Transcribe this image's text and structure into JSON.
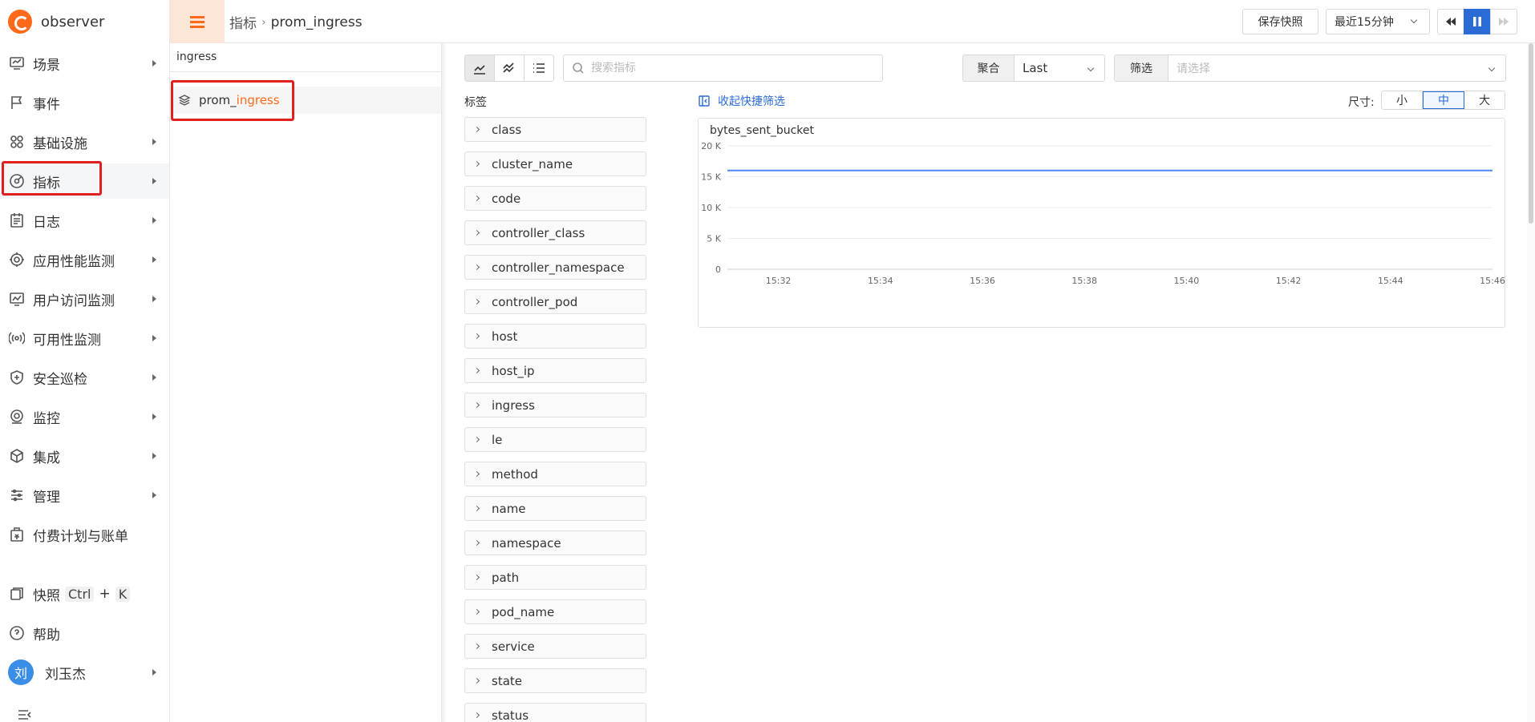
{
  "app": {
    "name": "observer"
  },
  "sidebar": {
    "items": [
      {
        "label": "场景",
        "icon": "dashboard-icon",
        "arrow": true
      },
      {
        "label": "事件",
        "icon": "flag-icon",
        "arrow": false
      },
      {
        "label": "基础设施",
        "icon": "grid-icon",
        "arrow": true
      },
      {
        "label": "指标",
        "icon": "metric-icon",
        "arrow": true
      },
      {
        "label": "日志",
        "icon": "log-icon",
        "arrow": true
      },
      {
        "label": "应用性能监测",
        "icon": "apm-icon",
        "arrow": true
      },
      {
        "label": "用户访问监测",
        "icon": "rum-icon",
        "arrow": true
      },
      {
        "label": "可用性监测",
        "icon": "signal-icon",
        "arrow": true
      },
      {
        "label": "安全巡检",
        "icon": "shield-icon",
        "arrow": true
      },
      {
        "label": "监控",
        "icon": "monitor-icon",
        "arrow": true
      },
      {
        "label": "集成",
        "icon": "cube-icon",
        "arrow": true
      },
      {
        "label": "管理",
        "icon": "settings-icon",
        "arrow": true
      },
      {
        "label": "付费计划与账单",
        "icon": "billing-icon",
        "arrow": false
      }
    ],
    "snapshot": {
      "label": "快照",
      "key1": "Ctrl",
      "plus": "+",
      "key2": "K"
    },
    "help": "帮助",
    "user": {
      "avatar": "刘",
      "name": "刘玉杰"
    }
  },
  "header": {
    "breadcrumb": [
      "指标",
      "prom_ingress"
    ],
    "save_snapshot": "保存快照",
    "time_range": "最近15分钟"
  },
  "metric_list": {
    "search_value": "ingress",
    "items": [
      {
        "prefix": "prom_",
        "highlight": "ingress"
      }
    ]
  },
  "toolbar": {
    "search_placeholder": "搜索指标",
    "aggregate_label": "聚合",
    "aggregate_value": "Last",
    "filter_label": "筛选",
    "filter_placeholder": "请选择"
  },
  "tags": {
    "title": "标签",
    "collapse_label": "收起快捷筛选",
    "items": [
      "class",
      "cluster_name",
      "code",
      "controller_class",
      "controller_namespace",
      "controller_pod",
      "host",
      "host_ip",
      "ingress",
      "le",
      "method",
      "name",
      "namespace",
      "path",
      "pod_name",
      "service",
      "state",
      "status"
    ]
  },
  "size": {
    "label": "尺寸:",
    "options": [
      "小",
      "中",
      "大"
    ],
    "selected": "中"
  },
  "chart_data": {
    "type": "line",
    "title": "bytes_sent_bucket",
    "x": [
      "15:32",
      "15:34",
      "15:36",
      "15:38",
      "15:40",
      "15:42",
      "15:44",
      "15:46"
    ],
    "yticks": [
      "0",
      "5 K",
      "10 K",
      "15 K",
      "20 K"
    ],
    "ylim": [
      0,
      20000
    ],
    "xlim": [
      "15:31",
      "15:46"
    ],
    "series": [
      {
        "values": [
          16000,
          16000,
          16000,
          16000,
          16000,
          16000,
          16000,
          16000
        ],
        "color": "#4a8af4"
      }
    ],
    "grid": true
  }
}
